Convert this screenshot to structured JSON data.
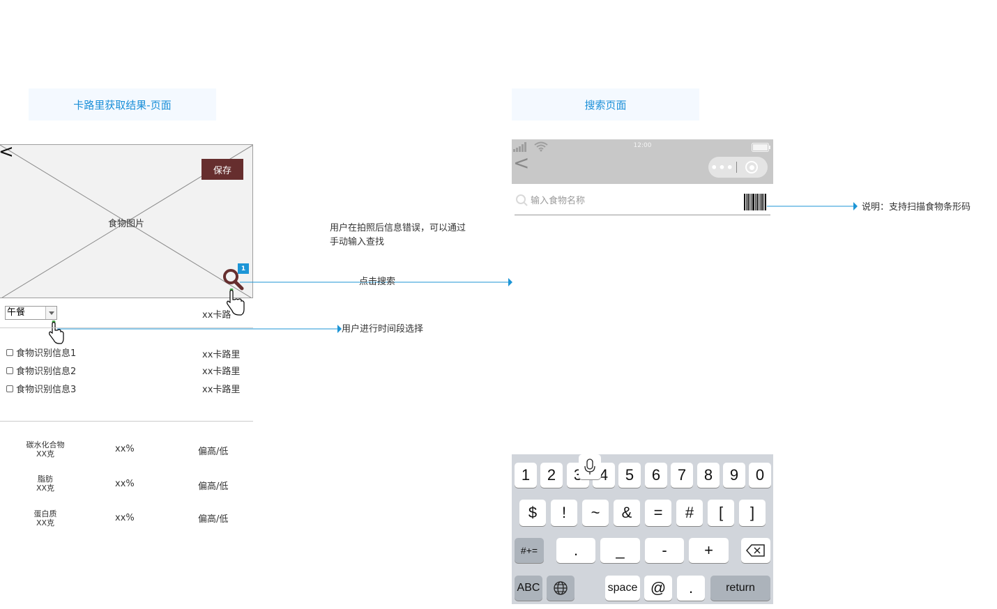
{
  "left_page": {
    "title": "卡路里获取结果-页面",
    "image_label": "食物图片",
    "back_icon": "chevron-left-icon",
    "save_label": "保存",
    "badge": "1",
    "meal_select_value": "午餐",
    "total_kcal": "xx卡路",
    "food_items": [
      {
        "name": "食物识别信息1",
        "kcal": "xx卡路里"
      },
      {
        "name": "食物识别信息2",
        "kcal": "xx卡路里"
      },
      {
        "name": "食物识别信息3",
        "kcal": "xx卡路里"
      }
    ],
    "nutrients": [
      {
        "name": "碳水化合物",
        "amount": "XX克",
        "percent": "xx%",
        "level": "偏高/低"
      },
      {
        "name": "脂肪",
        "amount": "XX克",
        "percent": "xx%",
        "level": "偏高/低"
      },
      {
        "name": "蛋白质",
        "amount": "XX克",
        "percent": "xx%",
        "level": "偏高/低"
      }
    ]
  },
  "annotations": {
    "error_note": "用户在拍照后信息错误，可以通过手动输入查找",
    "search_note": "点击搜索",
    "time_note": "用户进行时间段选择",
    "barcode_note": "说明：支持扫描食物条形码"
  },
  "right_page": {
    "title": "搜索页面",
    "status_time": "12:00",
    "search_placeholder": "输入食物名称",
    "icons": [
      "signal-icon",
      "wifi-icon",
      "battery-icon",
      "chevron-left-icon",
      "more-dots-icon",
      "target-icon",
      "search-icon",
      "barcode-icon"
    ]
  },
  "keyboard": {
    "row1": [
      "1",
      "2",
      "3",
      "4",
      "5",
      "6",
      "7",
      "8",
      "9",
      "0"
    ],
    "row2": [
      "$",
      "!",
      "~",
      "&",
      "=",
      "#",
      "[",
      "]"
    ],
    "row3_left": "#+=",
    "row3": [
      ".",
      "_",
      "-",
      "+"
    ],
    "abc": "ABC",
    "space": "space",
    "at": "@",
    "dot": ".",
    "return": "return"
  },
  "colors": {
    "title_text": "#1a8fd8",
    "title_bg": "#f4f9ff",
    "save_button": "#662e2e",
    "connector": "#1d95d6",
    "keyboard_bg": "#d1d5db"
  }
}
